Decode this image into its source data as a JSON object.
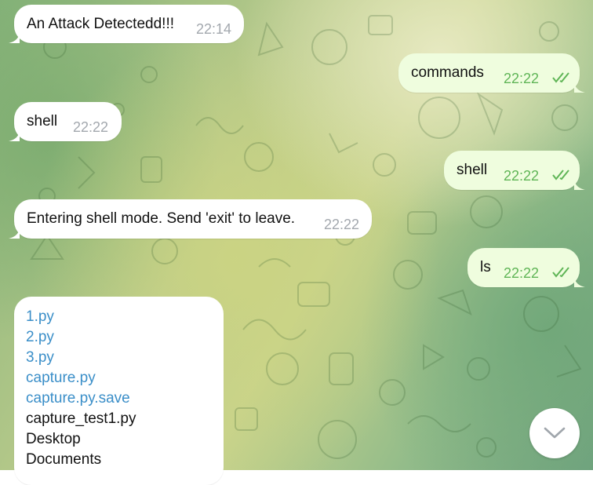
{
  "messages": [
    {
      "direction": "in",
      "text": "An Attack Detectedd!!!",
      "time": "22:14"
    },
    {
      "direction": "out",
      "text": "commands",
      "time": "22:22",
      "status": "read"
    },
    {
      "direction": "in",
      "text": "shell",
      "time": "22:22"
    },
    {
      "direction": "out",
      "text": "shell",
      "time": "22:22",
      "status": "read"
    },
    {
      "direction": "in",
      "text": "Entering shell mode. Send 'exit' to leave.",
      "time": "22:22"
    },
    {
      "direction": "out",
      "text": "ls",
      "time": "22:22",
      "status": "read"
    }
  ],
  "file_listing": {
    "lines": [
      {
        "text": "1.py",
        "is_link": true
      },
      {
        "text": "2.py",
        "is_link": true
      },
      {
        "text": "3.py",
        "is_link": true
      },
      {
        "text": "capture.py",
        "is_link": true
      },
      {
        "text": "capture.py.save",
        "is_link": true
      },
      {
        "text": "capture_test1.py",
        "is_link": false
      },
      {
        "text": "Desktop",
        "is_link": false
      },
      {
        "text": "Documents",
        "is_link": false
      }
    ]
  },
  "scroll_button": {
    "icon": "chevron-down-icon"
  },
  "colors": {
    "incoming_bubble": "#ffffff",
    "outgoing_bubble": "#effdde",
    "outgoing_time": "#5fb556",
    "incoming_time": "#a3a8ae",
    "link": "#3a8ec8"
  }
}
